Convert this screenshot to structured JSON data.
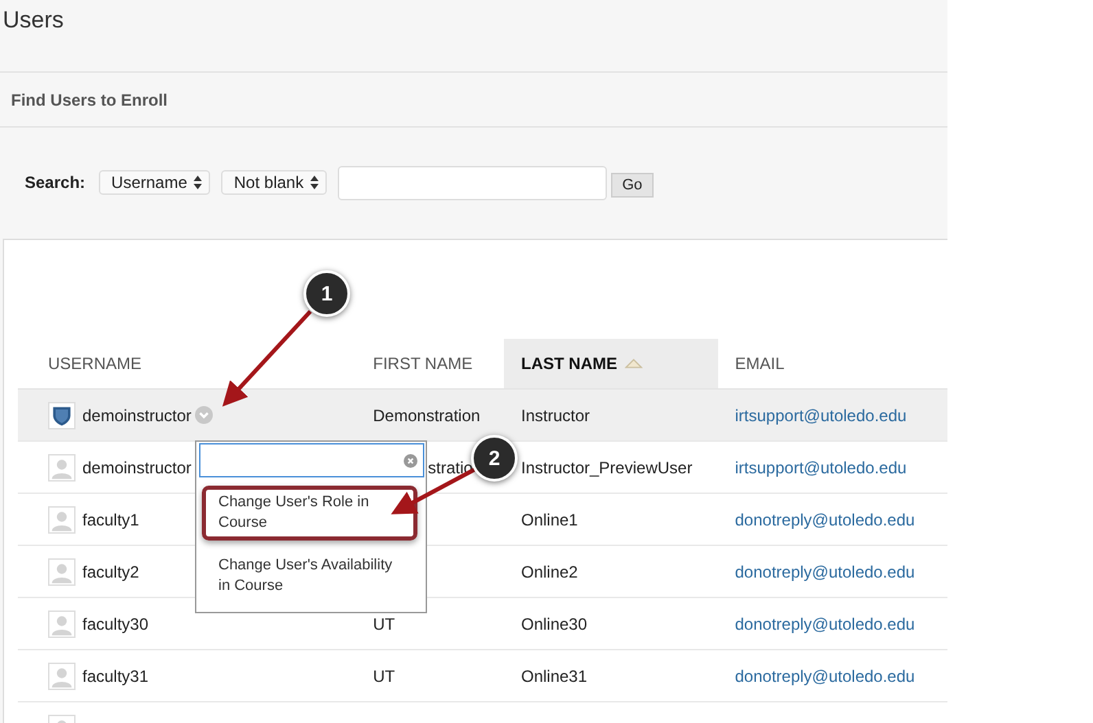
{
  "page_title": "Users",
  "section_title": "Find Users to Enroll",
  "search": {
    "label": "Search:",
    "field_select": "Username",
    "operator_select": "Not blank",
    "button": "Go"
  },
  "table": {
    "columns": [
      {
        "label": "USERNAME",
        "sorted": false
      },
      {
        "label": "FIRST NAME",
        "sorted": false
      },
      {
        "label": "LAST NAME",
        "sorted": true
      },
      {
        "label": "EMAIL",
        "sorted": false
      }
    ],
    "rows": [
      {
        "kind": "shield",
        "username": "demoinstructor",
        "first_name": "Demonstration",
        "last_name": "Instructor",
        "email": "irtsupport@utoledo.edu",
        "selected": true,
        "menu_button": true
      },
      {
        "kind": "person",
        "username": "demoinstructor",
        "first_name_tail": "stratio",
        "last_name": "Instructor_PreviewUser",
        "email": "irtsupport@utoledo.edu",
        "selected": false,
        "menu_button": false
      },
      {
        "kind": "person",
        "username": "faculty1",
        "last_name": "Online1",
        "email": "donotreply@utoledo.edu",
        "selected": false,
        "menu_button": false
      },
      {
        "kind": "person",
        "username": "faculty2",
        "last_name": "Online2",
        "email": "donotreply@utoledo.edu",
        "selected": false,
        "menu_button": false
      },
      {
        "kind": "person",
        "username": "faculty30",
        "first_name": "UT",
        "last_name": "Online30",
        "email": "donotreply@utoledo.edu",
        "selected": false,
        "menu_button": false
      },
      {
        "kind": "person",
        "username": "faculty31",
        "first_name": "UT",
        "last_name": "Online31",
        "email": "donotreply@utoledo.edu",
        "selected": false,
        "menu_button": false
      },
      {
        "kind": "person",
        "selected": false,
        "menu_button": false
      }
    ]
  },
  "context_menu": {
    "items": [
      {
        "label": "Change User's Role in Course",
        "selected": true
      },
      {
        "label": "Change User's Availability in Course",
        "selected": false
      }
    ]
  },
  "callouts": [
    {
      "label": "1"
    },
    {
      "label": "2"
    }
  ]
}
